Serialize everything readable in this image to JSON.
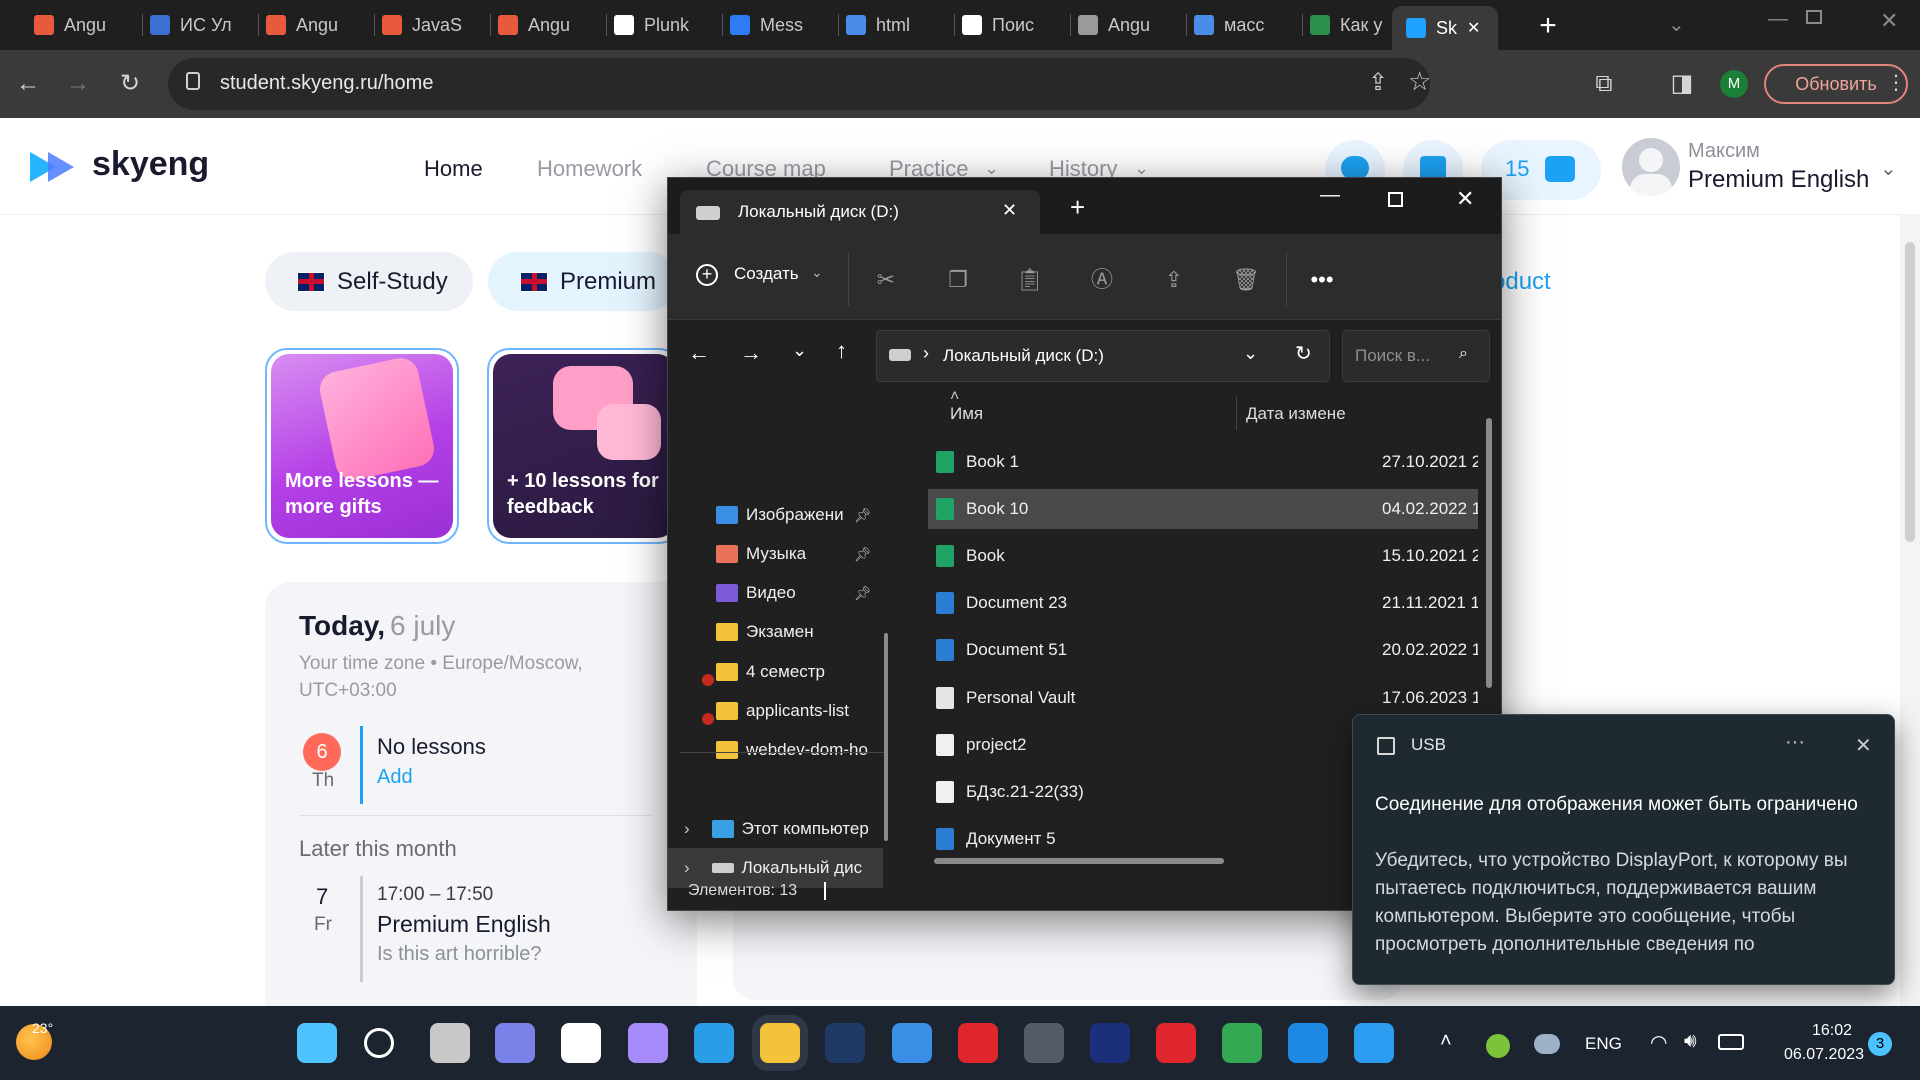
{
  "browser": {
    "tabs": [
      {
        "label": "Angu",
        "color": "#e85a3c"
      },
      {
        "label": "ИС Ул",
        "color": "#3b6fd1"
      },
      {
        "label": "Angu",
        "color": "#e85a3c"
      },
      {
        "label": "JavaS",
        "color": "#e85a3c"
      },
      {
        "label": "Angu",
        "color": "#e85a3c"
      },
      {
        "label": "Plunk",
        "color": "#ffffff"
      },
      {
        "label": "Mess",
        "color": "#2f7bf5"
      },
      {
        "label": "html",
        "color": "#4a8ce8"
      },
      {
        "label": "Поис",
        "color": "#ffffff"
      },
      {
        "label": "Angu",
        "color": "#9a9a9a"
      },
      {
        "label": "масс",
        "color": "#4a8ce8"
      },
      {
        "label": "Как у",
        "color": "#2d8f4e"
      },
      {
        "label": "Sk",
        "color": "#1fa2ff",
        "active": true
      }
    ],
    "new_tab": "+",
    "url": "student.skyeng.ru/home",
    "profile_initial": "M",
    "update_label": "Обновить"
  },
  "site": {
    "logo": "skyeng",
    "nav": [
      "Home",
      "Homework",
      "Course map",
      "Practice",
      "History"
    ],
    "coins": "15",
    "user": {
      "name": "Максим",
      "plan": "Premium English"
    },
    "pills": [
      "Self-Study",
      "Premium"
    ],
    "product_partial": "oduct",
    "cards": [
      "More lessons — more gifts",
      "+ 10 lessons for feedback"
    ],
    "today": {
      "label": "Today,",
      "date": "6 july",
      "tz": "Your time zone • Europe/Moscow, UTC+03:00"
    },
    "day1": {
      "num": "6",
      "dow": "Th",
      "title": "No lessons",
      "action": "Add"
    },
    "later": "Later this month",
    "day2": {
      "num": "7",
      "dow": "Fr",
      "time": "17:00 – 17:50",
      "title": "Premium English",
      "subtitle": "Is this art horrible?"
    }
  },
  "explorer": {
    "tab_title": "Локальный диск (D:)",
    "create": "Создать",
    "address": "Локальный диск (D:)",
    "search_placeholder": "Поиск в...",
    "col_name": "Имя",
    "col_date": "Дата измене",
    "nav": [
      {
        "label": "Изображени",
        "icon": "images",
        "pinned": true
      },
      {
        "label": "Музыка",
        "icon": "music",
        "pinned": true
      },
      {
        "label": "Видео",
        "icon": "video",
        "pinned": true
      },
      {
        "label": "Экзамен",
        "icon": "folder"
      },
      {
        "label": "4 семестр",
        "icon": "folder",
        "error": true
      },
      {
        "label": "applicants-list",
        "icon": "folder",
        "error": true
      },
      {
        "label": "webdev-dom-ho",
        "icon": "folder"
      },
      {
        "label": "Этот компьютер",
        "icon": "pc"
      },
      {
        "label": "Локальный дис",
        "icon": "drive",
        "selected": true
      }
    ],
    "files": [
      {
        "name": "Book 1",
        "date": "27.10.2021 2",
        "type": "xlsx"
      },
      {
        "name": "Book 10",
        "date": "04.02.2022 1",
        "type": "xlsx",
        "selected": true
      },
      {
        "name": "Book",
        "date": "15.10.2021 2",
        "type": "xlsx"
      },
      {
        "name": "Document 23",
        "date": "21.11.2021 1",
        "type": "docx"
      },
      {
        "name": "Document 51",
        "date": "20.02.2022 1",
        "type": "docx"
      },
      {
        "name": "Personal Vault",
        "date": "17.06.2023 1",
        "type": "link"
      },
      {
        "name": "project2",
        "date": "",
        "type": "py"
      },
      {
        "name": "БДзс.21-22(33)",
        "date": "",
        "type": "file"
      },
      {
        "name": "Документ 5",
        "date": "",
        "type": "docx"
      }
    ],
    "status": "Элементов: 13"
  },
  "notification": {
    "source": "USB",
    "title": "Соединение для отображения может быть ограничено",
    "body": "Убедитесь, что устройство DisplayPort, к которому вы пытаетесь подключиться, поддерживается вашим компьютером. Выберите это сообщение, чтобы просмотреть дополнительные сведения по"
  },
  "taskbar": {
    "weather": "23°",
    "lang": "ENG",
    "time": "16:02",
    "date": "06.07.2023",
    "badge": "3"
  }
}
